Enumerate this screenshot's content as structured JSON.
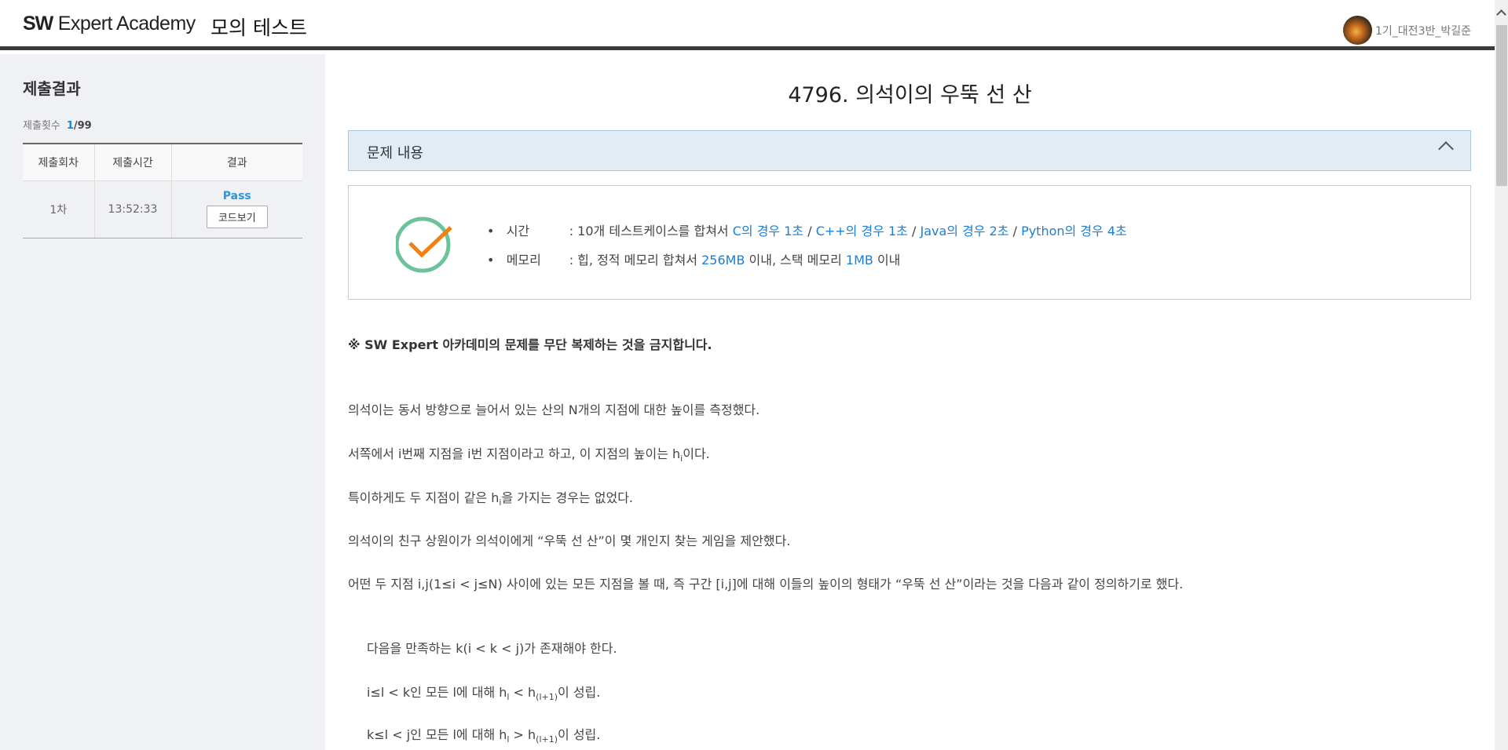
{
  "header": {
    "logo_bold": "SW",
    "logo_rest": "Expert Academy",
    "mode": "모의 테스트",
    "user": "1기_대전3반_박길준"
  },
  "sidebar": {
    "title": "제출결과",
    "count_label": "제출횟수",
    "count_used": "1",
    "count_sep": "/",
    "count_total": "99",
    "columns": [
      "제출회차",
      "제출시간",
      "결과"
    ],
    "rows": [
      {
        "round": "1차",
        "time": "13:52:33",
        "result": "Pass",
        "button": "코드보기"
      }
    ]
  },
  "problem": {
    "title": "4796. 의석이의 우뚝 선 산",
    "panel": "문제 내용",
    "time": {
      "label": "시간",
      "prefix": ": 10개 테스트케이스를 합쳐서 ",
      "c": "C의 경우 1초",
      "sep": " / ",
      "cpp": "C++의 경우 1초",
      "java": "Java의 경우 2초",
      "python": "Python의 경우 4초"
    },
    "memory": {
      "label": "메모리",
      "prefix": ": 힙, 정적 메모리 합쳐서 ",
      "heap": "256MB",
      "mid": " 이내, 스택 메모리 ",
      "stack": "1MB",
      "suffix": " 이내"
    },
    "notice": "※ SW Expert 아카데미의 문제를 무단 복제하는 것을 금지합니다.",
    "p1": "의석이는 동서 방향으로 늘어서 있는 산의 N개의 지점에 대한 높이를 측정했다.",
    "p2": {
      "a": "서쪽에서 i번째 지점을 i번 지점이라고 하고, 이 지점의 높이는 h",
      "s": "i",
      "b": "이다."
    },
    "p3": {
      "a": "특이하게도 두 지점이 같은 h",
      "s": "i",
      "b": "을 가지는 경우는 없었다."
    },
    "p4": "의석이의 친구 상원이가 의석이에게 “우뚝 선 산”이 몇 개인지 찾는 게임을 제안했다.",
    "p5": "어떤 두 지점 i,j(1≤i < j≤N) 사이에 있는 모든 지점을 볼 때, 즉 구간 [i,j]에 대해 이들의 높이의 형태가 “우뚝 선 산”이라는 것을 다음과 같이 정의하기로 했다.",
    "c1": "다음을 만족하는 k(i < k < j)가 존재해야 한다.",
    "c2": {
      "a": "i≤l < k인 모든 l에 대해 h",
      "s1": "l",
      "m": " < h",
      "s2": "(l+1)",
      "b": "이 성립."
    },
    "c3": {
      "a": "k≤l < j인 모든 l에 대해 h",
      "s1": "l",
      "m": " > h",
      "s2": "(l+1)",
      "b": "이 성립."
    }
  }
}
